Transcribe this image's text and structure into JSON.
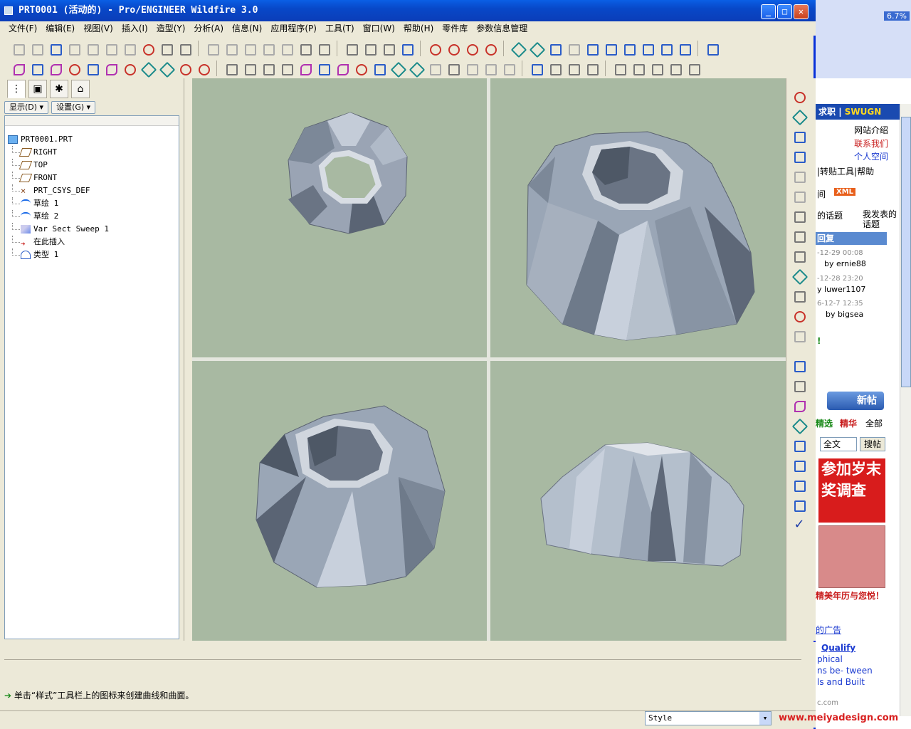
{
  "window": {
    "title": "PRT0001 (活动的) - Pro/ENGINEER Wildfire 3.0",
    "controls": {
      "minimize": "_",
      "maximize": "□",
      "close": "✕"
    }
  },
  "menu": [
    "文件(F)",
    "编辑(E)",
    "视图(V)",
    "插入(I)",
    "造型(Y)",
    "分析(A)",
    "信息(N)",
    "应用程序(P)",
    "工具(T)",
    "窗口(W)",
    "帮助(H)",
    "零件库",
    "参数信息管理"
  ],
  "navigator": {
    "display_btn": "显示(D) ▾",
    "settings_btn": "设置(G) ▾",
    "tree": {
      "root": "PRT0001.PRT",
      "items": [
        "RIGHT",
        "TOP",
        "FRONT",
        "PRT_CSYS_DEF",
        "草绘 1",
        "草绘 2",
        "Var Sect Sweep 1",
        "在此插入",
        "类型 1"
      ]
    }
  },
  "message": "单击“样式”工具栏上的图标来创建曲线和曲面。",
  "status": {
    "filter": "Style"
  },
  "web": {
    "top_badge": "6.7%",
    "header": "求职",
    "brand": "SWUGN",
    "links": [
      "网站介绍",
      "联系我们",
      "个人空间"
    ],
    "nav": "|转贴工具|帮助",
    "rss_text": "间",
    "rss_badge": "XML",
    "topics_left": "的话题",
    "topics_right": "我发表的话题",
    "reply_header": "回复",
    "posts": [
      {
        "time": "-12-29 00:08",
        "by": "by ernie88"
      },
      {
        "time": "-12-28 23:20",
        "by": "y luwer1107"
      },
      {
        "time": "6-12-7 12:35",
        "by": "by bigsea"
      }
    ],
    "exclaim": "!",
    "new_post": "新帖",
    "filter_tabs": [
      "精选",
      "精华",
      "全部"
    ],
    "search_scope": "全文",
    "search_btn": "搜帖",
    "ad_red": "参加岁末奖调查",
    "ad_pink_text": "精美年历与您悦！",
    "ad_link": "的广告",
    "qualify_title": "Qualify",
    "qualify_lines": [
      "phical",
      "ns be- tween",
      "ls and Built"
    ],
    "site_url": "c.com",
    "watermark": "www.meiyadesign.com"
  }
}
